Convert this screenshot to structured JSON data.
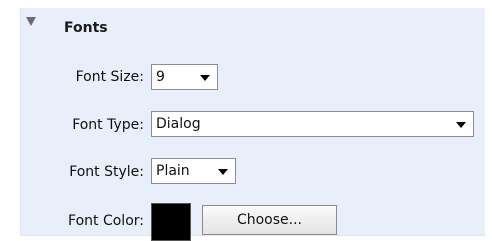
{
  "section": {
    "title": "Fonts",
    "expanded": true
  },
  "font_size": {
    "label": "Font Size:",
    "value": "9"
  },
  "font_type": {
    "label": "Font Type:",
    "value": "Dialog"
  },
  "font_style": {
    "label": "Font Style:",
    "value": "Plain"
  },
  "font_color": {
    "label": "Font Color:",
    "color": "#000000",
    "button_label": "Choose..."
  },
  "colors": {
    "panel_background": "#e9eefb"
  }
}
